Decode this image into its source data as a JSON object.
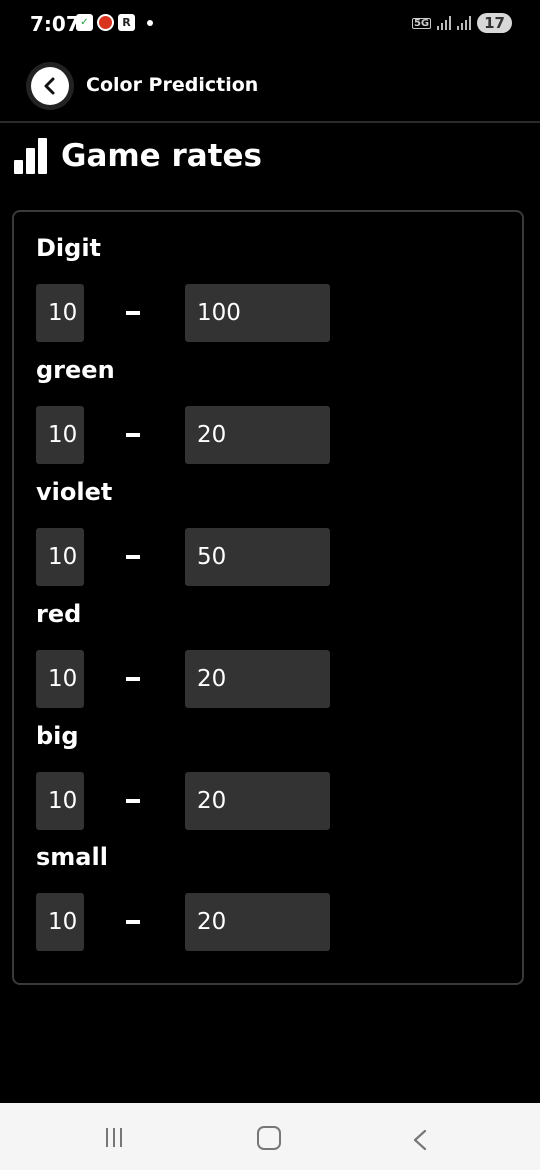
{
  "status_bar": {
    "time": "7:07",
    "network": "5G",
    "battery": "17"
  },
  "app_bar": {
    "title": "Color Prediction"
  },
  "page": {
    "heading": "Game rates"
  },
  "rates": [
    {
      "label": "Digit",
      "min": "10",
      "max": "100"
    },
    {
      "label": "green",
      "min": "10",
      "max": "20"
    },
    {
      "label": "violet",
      "min": "10",
      "max": "50"
    },
    {
      "label": "red",
      "min": "10",
      "max": "20"
    },
    {
      "label": "big",
      "min": "10",
      "max": "20"
    },
    {
      "label": "small",
      "min": "10",
      "max": "20"
    }
  ],
  "colors": {
    "background": "#000000",
    "field": "#333333",
    "card_border": "#3a3a3a",
    "nav_bar": "#f5f5f5"
  }
}
